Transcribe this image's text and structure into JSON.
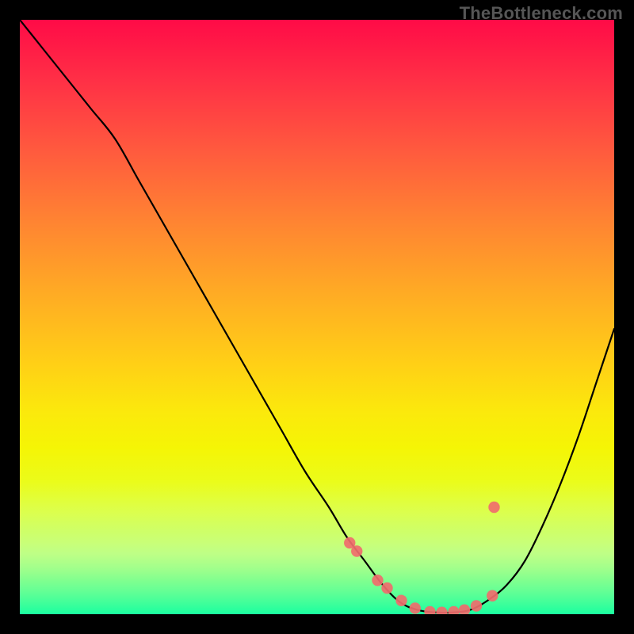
{
  "watermark": "TheBottleneck.com",
  "chart_data": {
    "type": "line",
    "title": "",
    "xlabel": "",
    "ylabel": "",
    "xlim": [
      0,
      100
    ],
    "ylim": [
      0,
      100
    ],
    "series": [
      {
        "name": "bottleneck-curve",
        "x": [
          0,
          4,
          8,
          12,
          16,
          20,
          24,
          28,
          32,
          36,
          40,
          44,
          48,
          52,
          55,
          58,
          61,
          64,
          67,
          70,
          73,
          76,
          79,
          82,
          85,
          88,
          91,
          94,
          97,
          100
        ],
        "values": [
          100,
          95,
          90,
          85,
          80,
          73,
          66,
          59,
          52,
          45,
          38,
          31,
          24,
          18,
          13,
          9,
          5,
          2,
          0.7,
          0.3,
          0.3,
          0.8,
          2.5,
          5,
          9,
          15,
          22,
          30,
          39,
          48
        ]
      }
    ],
    "markers": {
      "name": "highlight-dots",
      "x": [
        55.5,
        56.7,
        60.2,
        61.8,
        64.2,
        66.5,
        69.0,
        71.0,
        73.0,
        74.8,
        76.8,
        79.5,
        79.8
      ],
      "values": [
        12.0,
        10.6,
        5.7,
        4.4,
        2.3,
        1.0,
        0.4,
        0.3,
        0.4,
        0.7,
        1.4,
        3.1,
        18.0
      ]
    },
    "marker_color": "#f06d6d",
    "curve_color": "#000000"
  }
}
